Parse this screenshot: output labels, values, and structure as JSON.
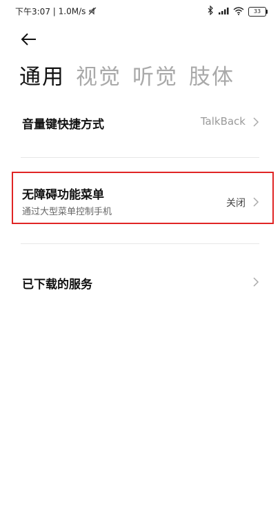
{
  "status_bar": {
    "time": "下午3:07",
    "network_speed": "1.0M/s",
    "battery_level": "33",
    "icons": [
      "mute-icon",
      "bluetooth-icon",
      "signal-icon",
      "wifi-icon",
      "battery-icon"
    ]
  },
  "header": {
    "back_icon": "back-arrow-icon"
  },
  "tabs": [
    {
      "label": "通用",
      "active": true
    },
    {
      "label": "视觉",
      "active": false
    },
    {
      "label": "听觉",
      "active": false
    },
    {
      "label": "肢体",
      "active": false
    }
  ],
  "settings": {
    "volume_shortcut": {
      "title": "音量键快捷方式",
      "value": "TalkBack"
    },
    "accessibility_menu": {
      "title": "无障碍功能菜单",
      "subtitle": "通过大型菜单控制手机",
      "value": "关闭"
    },
    "downloaded_services": {
      "title": "已下载的服务"
    }
  },
  "colors": {
    "highlight_border": "#e02424",
    "inactive_tab": "#a9a9a9",
    "value_text": "#999999"
  }
}
